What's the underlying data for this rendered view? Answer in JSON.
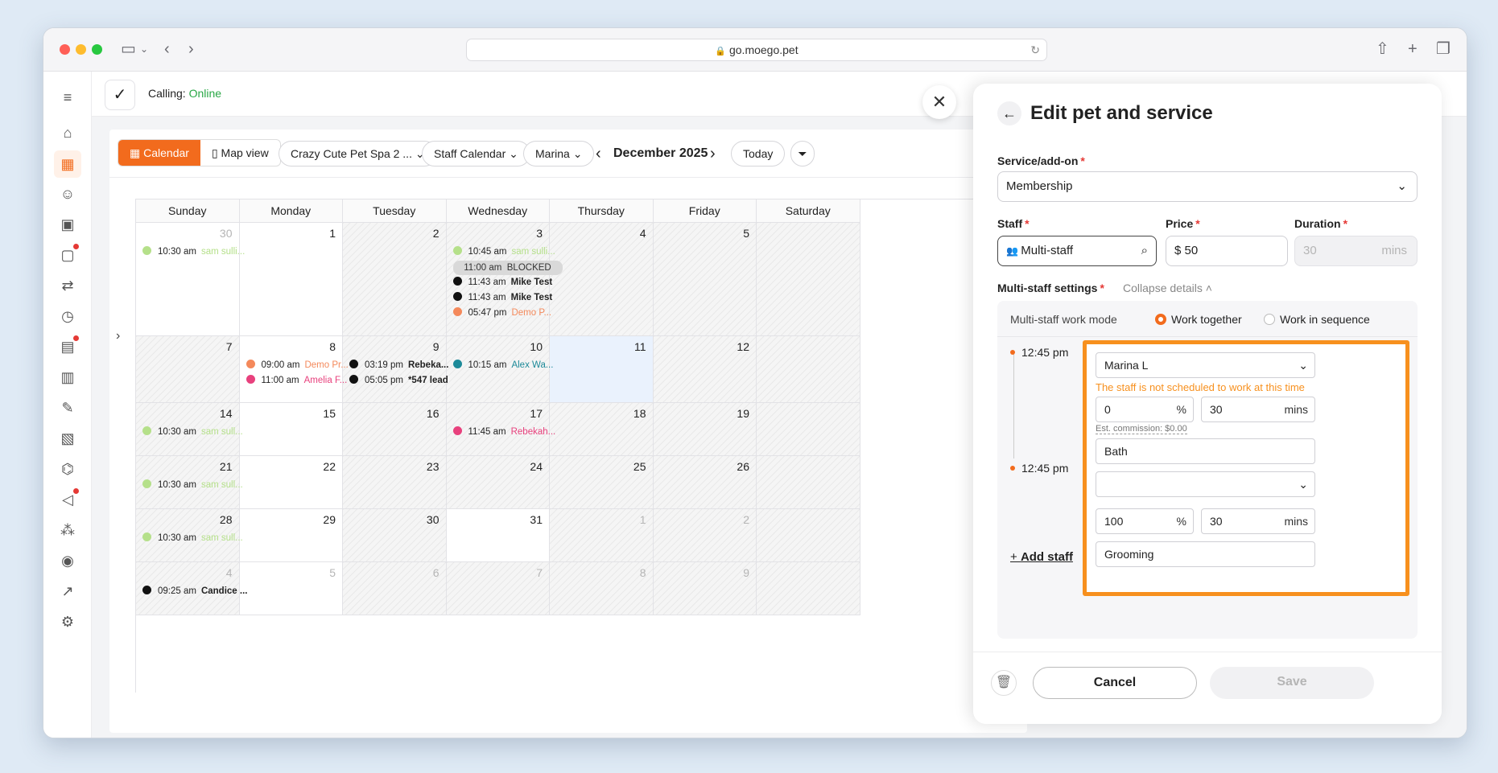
{
  "browser": {
    "url": "go.moego.pet"
  },
  "appbar": {
    "calling_label": "Calling:",
    "calling_status": "Online"
  },
  "toolbar": {
    "calendar_tab": "Calendar",
    "map_tab": "Map view",
    "business": "Crazy Cute Pet Spa 2 ...",
    "view": "Staff Calendar",
    "staff": "Marina",
    "month": "December 2025",
    "today": "Today"
  },
  "calendar": {
    "days": [
      "Sunday",
      "Monday",
      "Tuesday",
      "Wednesday",
      "Thursday",
      "Friday",
      "Saturday"
    ],
    "weeks": [
      [
        "30",
        "1",
        "2",
        "3",
        "4",
        "5",
        ""
      ],
      [
        "7",
        "8",
        "9",
        "10",
        "11",
        "12",
        ""
      ],
      [
        "14",
        "15",
        "16",
        "17",
        "18",
        "19",
        ""
      ],
      [
        "21",
        "22",
        "23",
        "24",
        "25",
        "26",
        ""
      ],
      [
        "28",
        "29",
        "30",
        "31",
        "1",
        "2",
        ""
      ],
      [
        "4",
        "5",
        "6",
        "7",
        "8",
        "9",
        ""
      ]
    ],
    "events": [
      {
        "time": "10:30 am",
        "name": "sam sulli...",
        "color": "#b5e08a"
      },
      {
        "time": "10:45 am",
        "name": "sam sulli...",
        "color": "#b5e08a"
      },
      {
        "time": "11:00 am",
        "name": "BLOCKED",
        "color": "#d9d9d9"
      },
      {
        "time": "11:43 am",
        "name": "Mike Test",
        "color": "#111111"
      },
      {
        "time": "11:43 am",
        "name": "Mike Test",
        "color": "#111111"
      },
      {
        "time": "05:47 pm",
        "name": "Demo P...",
        "color": "#f4895b"
      },
      {
        "time": "09:00 am",
        "name": "Demo Pr...",
        "color": "#f4895b"
      },
      {
        "time": "11:00 am",
        "name": "Amelia F...",
        "color": "#e8417d"
      },
      {
        "time": "03:19 pm",
        "name": "Rebeka...",
        "color": "#111111"
      },
      {
        "time": "05:05 pm",
        "name": "*547 lead",
        "color": "#111111"
      },
      {
        "time": "10:15 am",
        "name": "Alex Wa...",
        "color": "#1d8a99"
      },
      {
        "time": "10:30 am",
        "name": "sam sull...",
        "color": "#b5e08a"
      },
      {
        "time": "11:45 am",
        "name": "Rebekah...",
        "color": "#e8417d"
      },
      {
        "time": "10:30 am",
        "name": "sam sull...",
        "color": "#b5e08a"
      },
      {
        "time": "10:30 am",
        "name": "sam sull...",
        "color": "#b5e08a"
      },
      {
        "time": "09:25 am",
        "name": "Candice ...",
        "color": "#111111"
      }
    ]
  },
  "drawer": {
    "title": "Edit pet and service",
    "service_label": "Service/add-on",
    "service_value": "Membership",
    "staff_label": "Staff",
    "staff_value": "Multi-staff",
    "price_label": "Price",
    "price_currency": "$",
    "price_value": "50",
    "duration_label": "Duration",
    "duration_value": "30",
    "duration_unit": "mins",
    "ms_label": "Multi-staff settings",
    "collapse": "Collapse details",
    "work_mode_label": "Multi-staff work mode",
    "work_together": "Work together",
    "work_sequence": "Work in sequence",
    "rows": [
      {
        "time": "12:45 pm",
        "staff": "Marina L",
        "warning": "The staff is not scheduled to work at this time",
        "percent": "0",
        "mins": "30",
        "commission": "Est. commission: $0.00",
        "service": "Bath"
      },
      {
        "time": "12:45 pm",
        "staff": "",
        "percent": "100",
        "mins": "30",
        "service": "Grooming"
      }
    ],
    "percent_symbol": "%",
    "mins_unit": "mins",
    "add_staff": "Add staff",
    "cancel": "Cancel",
    "save": "Save"
  },
  "colors": {
    "accent": "#f26b1d",
    "highlight": "#f7901e",
    "online": "#28a745",
    "warning": "#f7901e"
  }
}
